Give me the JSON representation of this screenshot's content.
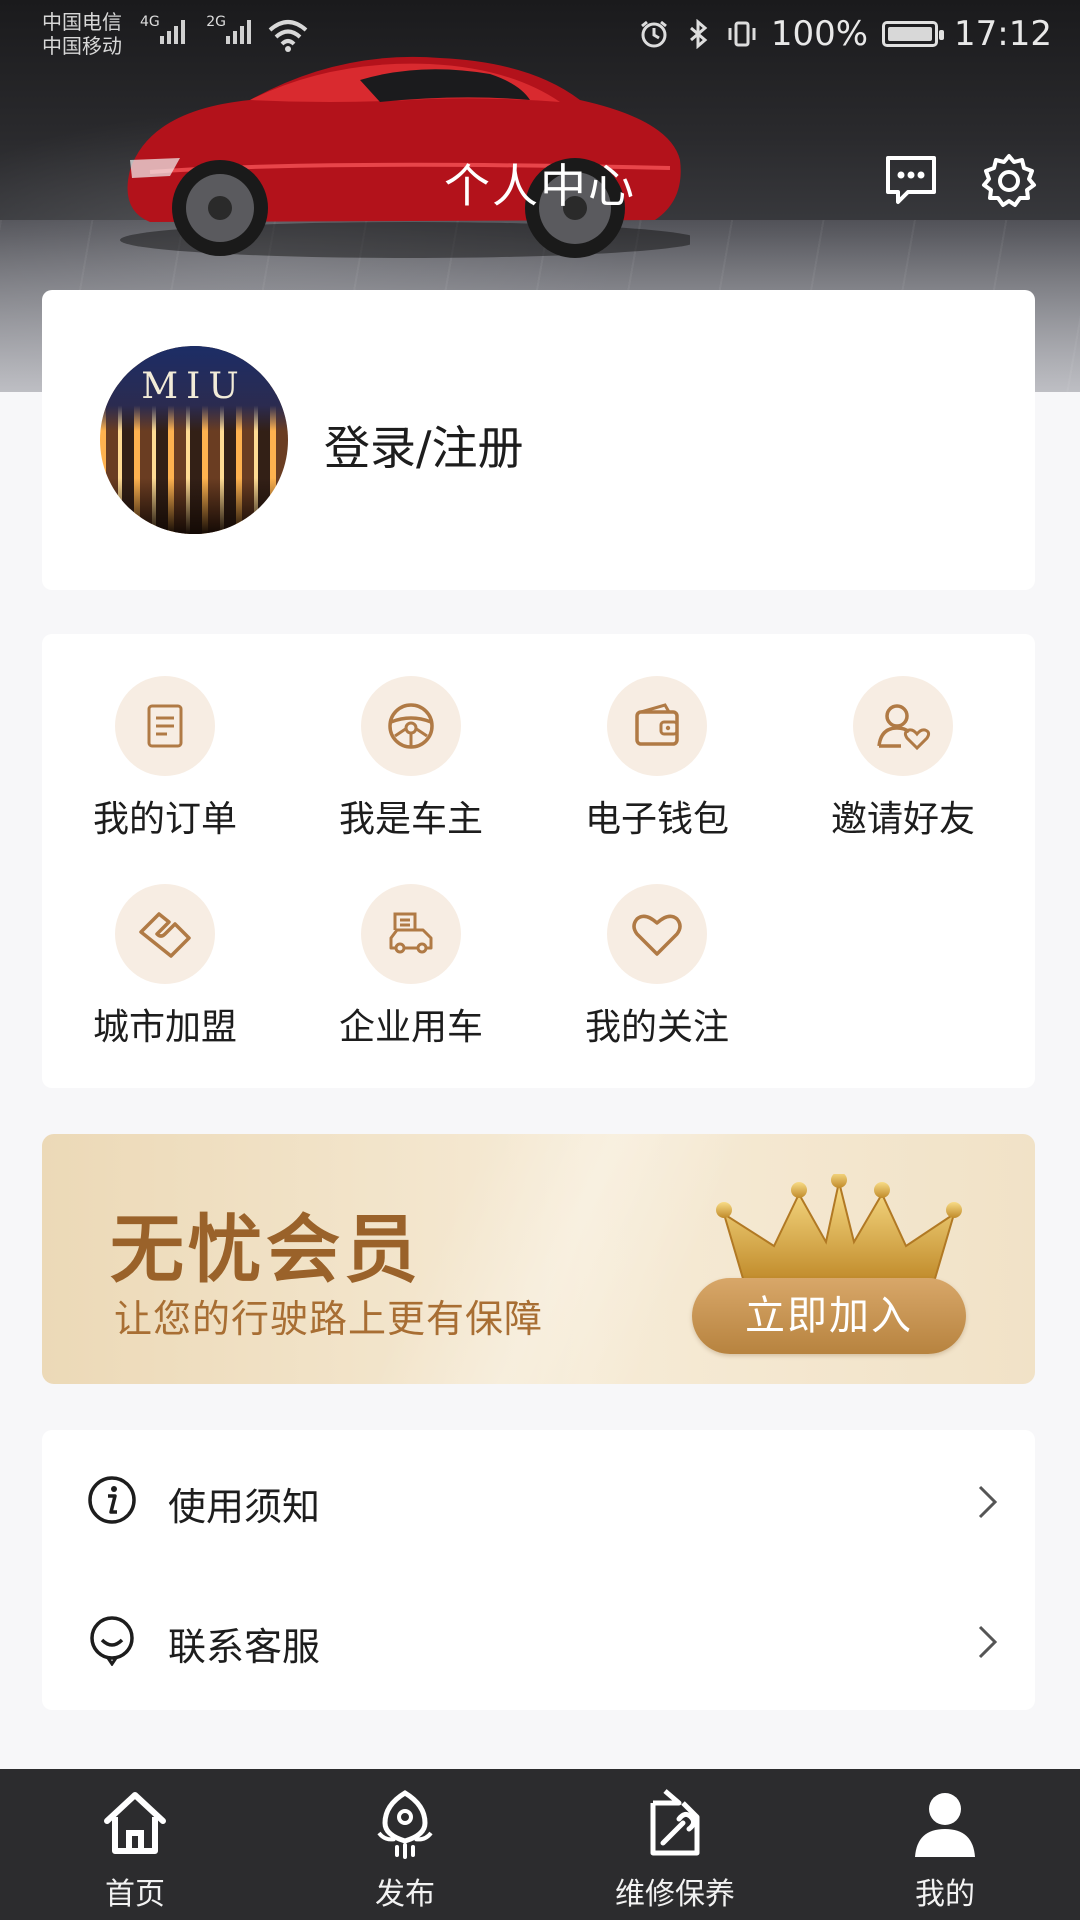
{
  "status_bar": {
    "carrier_1": "中国电信",
    "carrier_2": "中国移动",
    "net_1": "4G",
    "net_2": "2G",
    "battery": "100%",
    "time": "17:12"
  },
  "header": {
    "title": "个人中心"
  },
  "profile": {
    "avatar_text": "MIU",
    "login_label": "登录/注册"
  },
  "menu": {
    "items": [
      {
        "label": "我的订单",
        "icon": "order-icon"
      },
      {
        "label": "我是车主",
        "icon": "steering-wheel-icon"
      },
      {
        "label": "电子钱包",
        "icon": "wallet-icon"
      },
      {
        "label": "邀请好友",
        "icon": "invite-friend-icon"
      },
      {
        "label": "城市加盟",
        "icon": "handshake-icon"
      },
      {
        "label": "企业用车",
        "icon": "enterprise-car-icon"
      },
      {
        "label": "我的关注",
        "icon": "heart-icon"
      }
    ]
  },
  "member": {
    "title": "无忧会员",
    "subtitle": "让您的行驶路上更有保障",
    "join_label": "立即加入"
  },
  "list": {
    "items": [
      {
        "label": "使用须知",
        "icon": "info-icon"
      },
      {
        "label": "联系客服",
        "icon": "customer-service-icon"
      }
    ]
  },
  "bottom_nav": {
    "items": [
      {
        "label": "首页",
        "icon": "home-icon"
      },
      {
        "label": "发布",
        "icon": "publish-icon"
      },
      {
        "label": "维修保养",
        "icon": "repair-icon"
      },
      {
        "label": "我的",
        "icon": "user-icon",
        "active": true
      }
    ]
  },
  "colors": {
    "accent_gold": "#b7833f",
    "icon_brown": "#b07a45",
    "nav_bg": "#2c2c2e"
  }
}
